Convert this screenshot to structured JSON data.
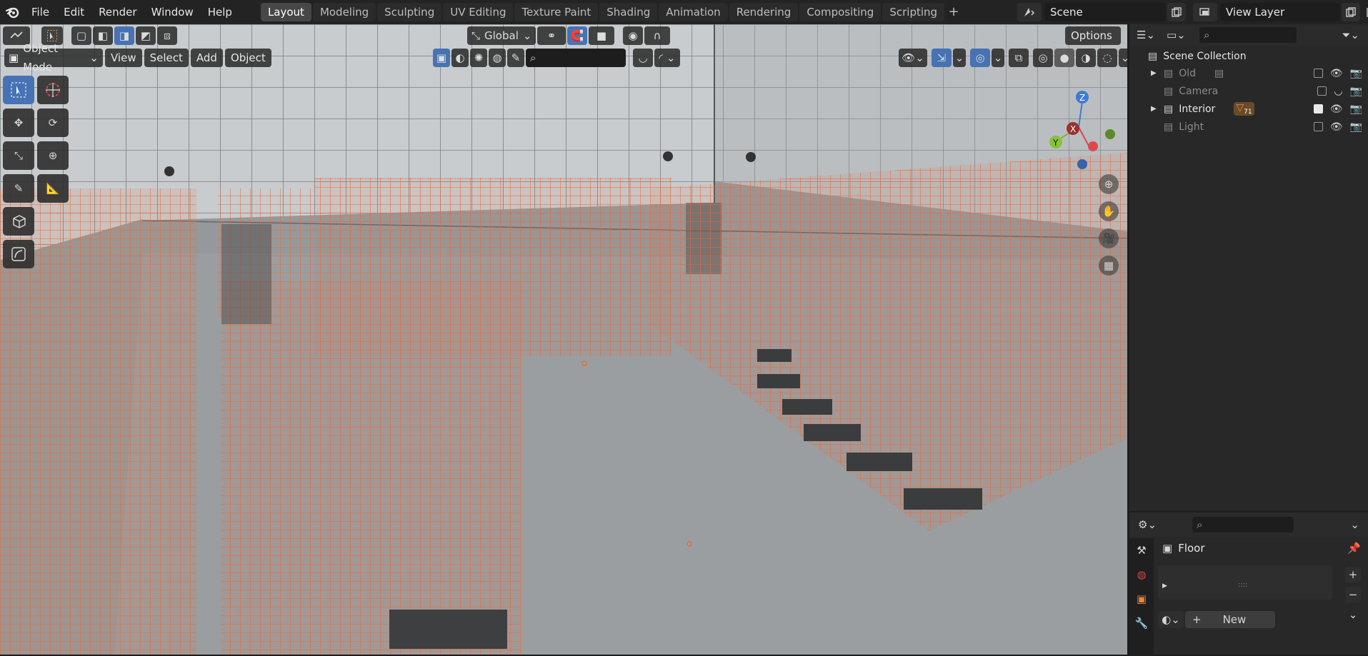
{
  "menu": {
    "items": [
      "File",
      "Edit",
      "Render",
      "Window",
      "Help"
    ]
  },
  "workspaces": {
    "tabs": [
      "Layout",
      "Modeling",
      "Sculpting",
      "UV Editing",
      "Texture Paint",
      "Shading",
      "Animation",
      "Rendering",
      "Compositing",
      "Scripting"
    ],
    "active": "Layout",
    "add_label": "+"
  },
  "scene": {
    "name": "Scene",
    "view_layer": "View Layer"
  },
  "viewport_header": {
    "transform_orientation": "Global",
    "options_label": "Options",
    "mode": "Object Mode",
    "menus": [
      "View",
      "Select",
      "Add",
      "Object"
    ]
  },
  "outliner": {
    "root": "Scene Collection",
    "items": [
      {
        "name": "Old",
        "dim": true,
        "checked": false,
        "expandable": true
      },
      {
        "name": "Camera",
        "dim": true,
        "checked": false,
        "expandable": false
      },
      {
        "name": "Interior",
        "dim": false,
        "checked": true,
        "expandable": true,
        "badge": "71"
      },
      {
        "name": "Light",
        "dim": true,
        "checked": false,
        "expandable": false
      }
    ]
  },
  "properties": {
    "object_name": "Floor",
    "slot_dots": "::::",
    "new_label": "New"
  },
  "gizmo": {
    "axes": [
      "Z",
      "X",
      "Y"
    ]
  },
  "colors": {
    "accent": "#4772b3",
    "selection_orange": "#e86a3a",
    "viewport_bg": "#8f9396"
  }
}
